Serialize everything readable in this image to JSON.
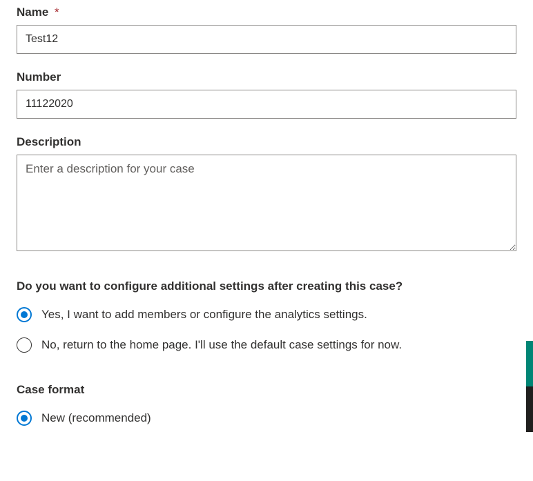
{
  "fields": {
    "name": {
      "label": "Name",
      "required_marker": "*",
      "value": "Test12"
    },
    "number": {
      "label": "Number",
      "value": "11122020"
    },
    "description": {
      "label": "Description",
      "placeholder": "Enter a description for your case",
      "value": ""
    }
  },
  "configure_section": {
    "heading": "Do you want to configure additional settings after creating this case?",
    "options": {
      "yes": "Yes, I want to add members or configure the analytics settings.",
      "no": "No, return to the home page. I'll use the default case settings for now."
    },
    "selected": "yes"
  },
  "case_format_section": {
    "heading": "Case format",
    "options": {
      "new": "New (recommended)"
    },
    "selected": "new"
  }
}
